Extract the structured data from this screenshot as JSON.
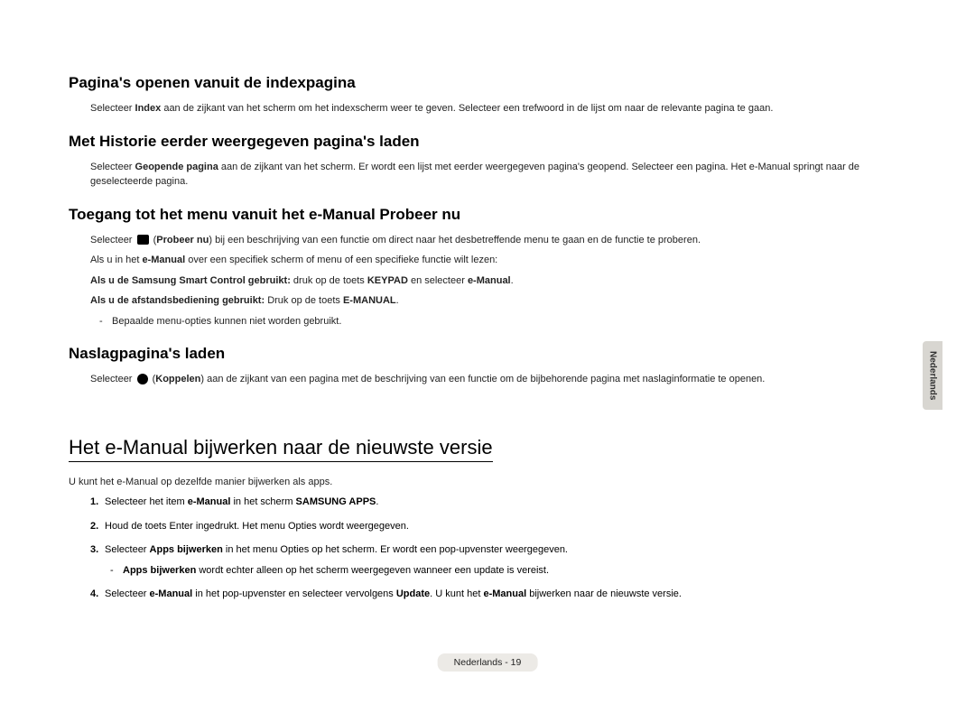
{
  "sections": {
    "s1": {
      "title": "Pagina's openen vanuit de indexpagina",
      "body_pre": "Selecteer ",
      "body_b1": "Index",
      "body_post": " aan de zijkant van het scherm om het indexscherm weer te geven. Selecteer een trefwoord in de lijst om naar de relevante pagina te gaan."
    },
    "s2": {
      "title": "Met Historie eerder weergegeven pagina's laden",
      "body_pre": "Selecteer ",
      "body_b1": "Geopende pagina",
      "body_post": " aan de zijkant van het scherm. Er wordt een lijst met eerder weergegeven pagina's geopend. Selecteer een pagina. Het e-Manual springt naar de geselecteerde pagina."
    },
    "s3": {
      "title": "Toegang tot het menu vanuit het e-Manual Probeer nu",
      "p1_pre": "Selecteer ",
      "p1_paren_open": " (",
      "p1_b1": "Probeer nu",
      "p1_paren_close": ") bij een beschrijving van een functie om direct naar het desbetreffende menu te gaan en de functie te proberen.",
      "p2_pre": "Als u in het ",
      "p2_b1": "e-Manual",
      "p2_post": " over een specifiek scherm of menu of een specifieke functie wilt lezen:",
      "p3_b": "Als u de Samsung Smart Control gebruikt:",
      "p3_mid": " druk op de toets ",
      "p3_b2": "KEYPAD",
      "p3_mid2": " en selecteer ",
      "p3_b3": "e-Manual",
      "p3_end": ".",
      "p4_b": "Als u de afstandsbediening gebruikt:",
      "p4_mid": " Druk op de toets ",
      "p4_b2": "E-MANUAL",
      "p4_end": ".",
      "bullet": "Bepaalde menu-opties kunnen niet worden gebruikt."
    },
    "s4": {
      "title": "Naslagpagina's laden",
      "body_pre": "Selecteer ",
      "body_paren_open": " (",
      "body_b1": "Koppelen",
      "body_paren_close": ") aan de zijkant van een pagina met de beschrijving van een functie om de bijbehorende pagina met naslaginformatie te openen."
    }
  },
  "main": {
    "title": "Het e-Manual bijwerken naar de nieuwste versie",
    "intro": "U kunt het e-Manual op dezelfde manier bijwerken als apps.",
    "steps": {
      "1_pre": "Selecteer het item ",
      "1_b1": "e-Manual",
      "1_mid": " in het scherm ",
      "1_b2": "SAMSUNG APPS",
      "1_end": ".",
      "2": "Houd de toets Enter ingedrukt. Het menu Opties wordt weergegeven.",
      "3_pre": "Selecteer ",
      "3_b1": "Apps bijwerken",
      "3_post": " in het menu Opties op het scherm. Er wordt een pop-upvenster weergegeven.",
      "3_sub_b": "Apps bijwerken",
      "3_sub_post": " wordt echter alleen op het scherm weergegeven wanneer een update is vereist.",
      "4_pre": "Selecteer ",
      "4_b1": "e-Manual",
      "4_mid": " in het pop-upvenster en selecteer vervolgens ",
      "4_b2": "Update",
      "4_mid2": ". U kunt het ",
      "4_b3": "e-Manual",
      "4_end": " bijwerken naar de nieuwste versie."
    }
  },
  "sidetab": "Nederlands",
  "footer": "Nederlands - 19"
}
